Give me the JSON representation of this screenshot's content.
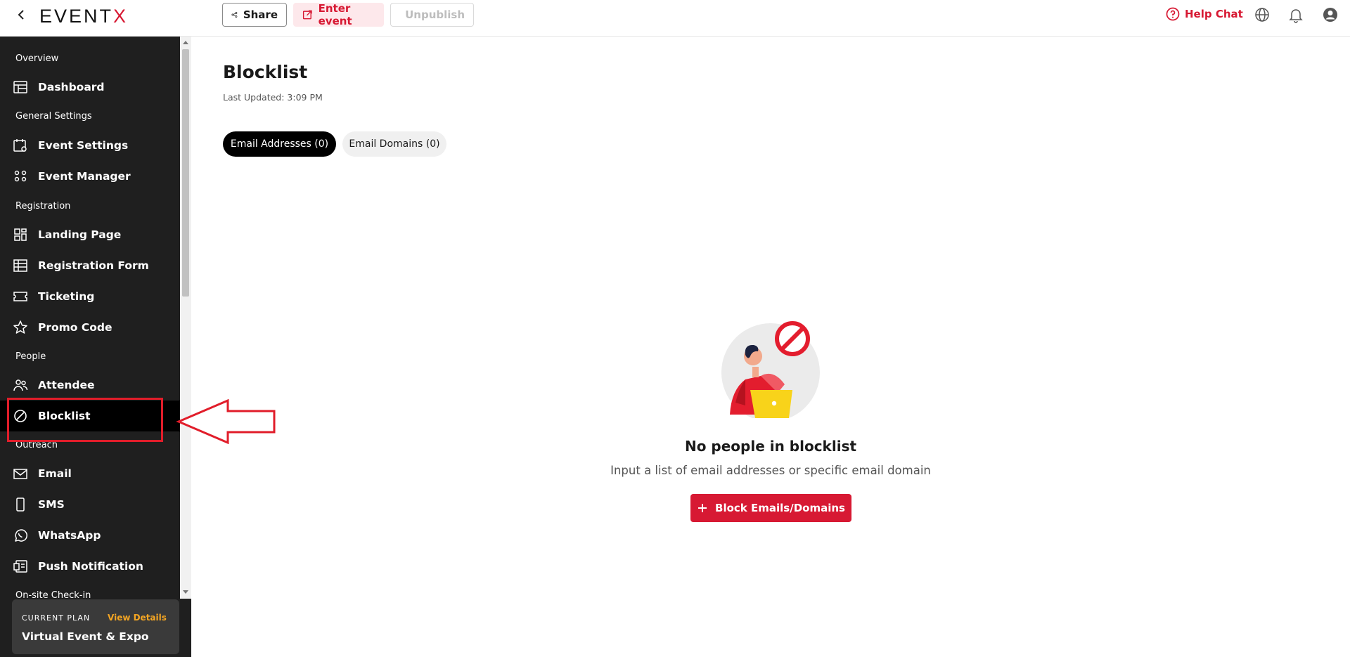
{
  "topbar": {
    "logo_main": "EVENT",
    "logo_accent": "X",
    "share_label": "Share",
    "enter_label": "Enter event",
    "unpublish_label": "Unpublish",
    "help_label": "Help Chat"
  },
  "sidebar": {
    "sections": {
      "overview": "Overview",
      "general": "General Settings",
      "registration": "Registration",
      "people": "People",
      "outreach": "Outreach",
      "onsite": "On-site Check-in"
    },
    "items": {
      "dashboard": "Dashboard",
      "event_settings": "Event Settings",
      "event_manager": "Event Manager",
      "landing_page": "Landing Page",
      "registration_form": "Registration Form",
      "ticketing": "Ticketing",
      "promo_code": "Promo Code",
      "attendee": "Attendee",
      "blocklist": "Blocklist",
      "email": "Email",
      "sms": "SMS",
      "whatsapp": "WhatsApp",
      "push": "Push Notification"
    },
    "active_item": "blocklist"
  },
  "plan": {
    "label": "CURRENT PLAN",
    "link": "View Details",
    "name": "Virtual Event & Expo"
  },
  "main": {
    "title": "Blocklist",
    "last_updated": "Last Updated: 3:09 PM",
    "tabs": [
      {
        "label": "Email Addresses (0)",
        "active": true
      },
      {
        "label": "Email Domains (0)",
        "active": false
      }
    ],
    "empty_title": "No people in blocklist",
    "empty_subtitle": "Input a list of email addresses or specific email domain",
    "block_button": "Block Emails/Domains"
  },
  "colors": {
    "brand_red": "#d71933",
    "sidebar_bg": "#1f1f1f",
    "accent_orange": "#f5a623",
    "annotation_red": "#e11d2a"
  },
  "icons": {
    "back": "chevron-left-icon",
    "share": "share-icon",
    "enter": "external-link-icon",
    "unpublish": "upload-icon",
    "help": "question-circle-icon",
    "language": "globe-icon",
    "notifications": "bell-icon",
    "account": "user-circle-icon"
  }
}
